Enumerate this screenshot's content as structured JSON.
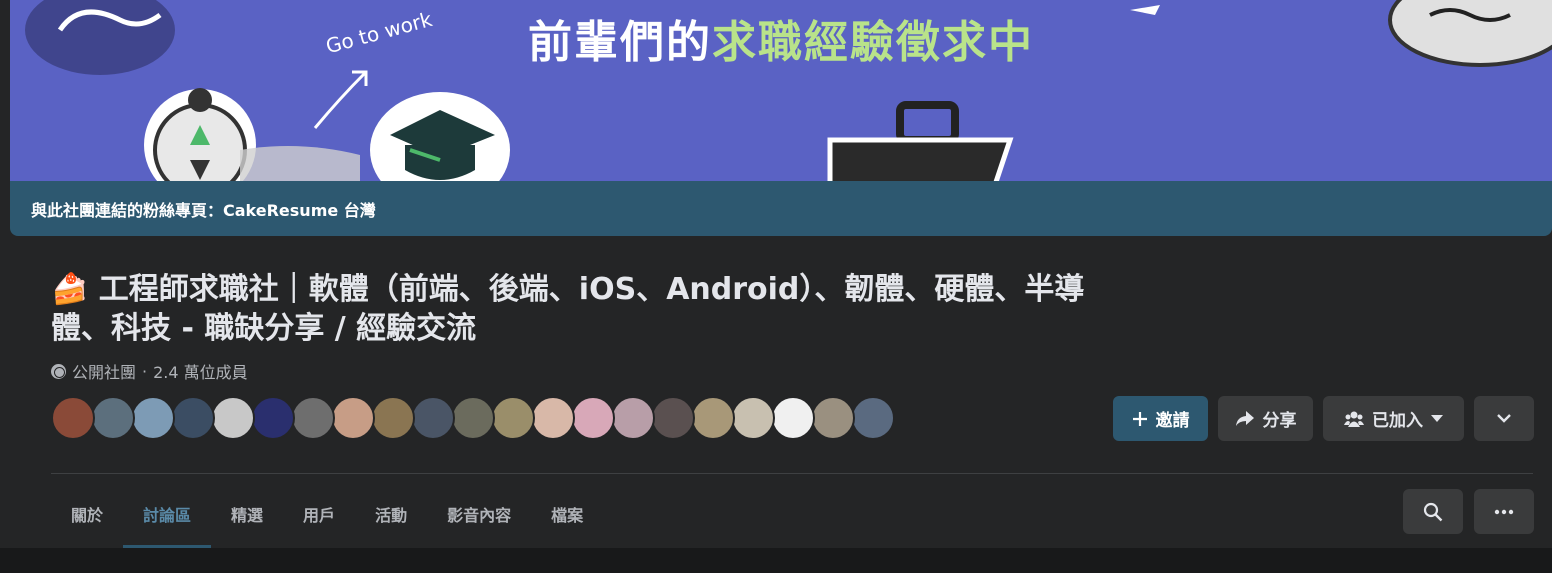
{
  "cover": {
    "headline_main": "前輩們的",
    "headline_highlight": "求職經驗徵求中",
    "sticker_text": "Go to work",
    "linked_page_label": "與此社團連結的粉絲專頁：CakeResume 台灣",
    "colors": {
      "background": "#5a62c4",
      "bar": "#2d5870",
      "highlight": "#b9e38a"
    }
  },
  "group": {
    "name": "🍰 工程師求職社｜軟體（前端、後端、iOS、Android）、韌體、硬體、半導體、科技 - 職缺分享 / 經驗交流",
    "privacy": "公開社團",
    "separator": "·",
    "members": "2.4 萬位成員"
  },
  "avatars": [
    {
      "color": "#8a4a38"
    },
    {
      "color": "#5c6f7d"
    },
    {
      "color": "#7d9bb5"
    },
    {
      "color": "#3b4d63"
    },
    {
      "color": "#c8c8c8"
    },
    {
      "color": "#2a2f6e"
    },
    {
      "color": "#6e6e6e"
    },
    {
      "color": "#c79d86"
    },
    {
      "color": "#8a7552"
    },
    {
      "color": "#4a5566"
    },
    {
      "color": "#6b6b5d"
    },
    {
      "color": "#9a8e6a"
    },
    {
      "color": "#d8b8a8"
    },
    {
      "color": "#d8a8b8"
    },
    {
      "color": "#b89ea8"
    },
    {
      "color": "#5a5050"
    },
    {
      "color": "#a89878"
    },
    {
      "color": "#c8c0b0"
    },
    {
      "color": "#f0f0f0"
    },
    {
      "color": "#9a9080"
    },
    {
      "color": "#5a6a80"
    }
  ],
  "actions": {
    "invite": "邀請",
    "share": "分享",
    "joined": "已加入"
  },
  "tabs": [
    {
      "label": "關於"
    },
    {
      "label": "討論區"
    },
    {
      "label": "精選"
    },
    {
      "label": "用戶"
    },
    {
      "label": "活動"
    },
    {
      "label": "影音內容"
    },
    {
      "label": "檔案"
    }
  ],
  "active_tab": "討論區"
}
